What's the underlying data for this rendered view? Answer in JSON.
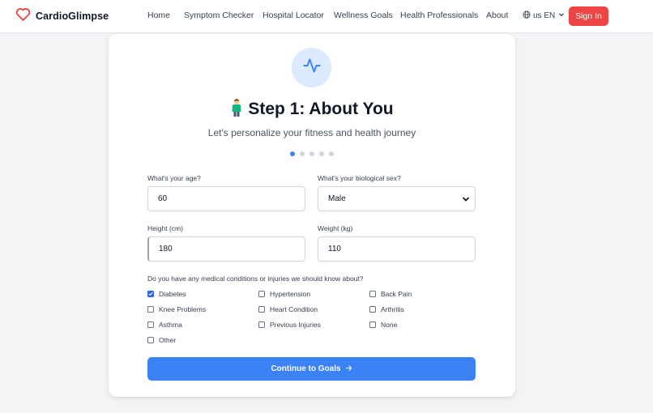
{
  "brand": {
    "name": "CardioGlimpse",
    "accent": "#ef4444"
  },
  "nav": {
    "links": [
      "Home",
      "Symptom Checker",
      "Hospital Locator",
      "Wellness Goals",
      "Health Professionals",
      "About"
    ],
    "language": "us EN",
    "sign_in": "Sign In"
  },
  "step": {
    "icon": "pulse-icon",
    "title": "Step 1: About You",
    "subtitle": "Let's personalize your fitness and health journey",
    "current_step": 1,
    "total_steps": 5
  },
  "form": {
    "age": {
      "label": "What's your age?",
      "value": "60"
    },
    "sex": {
      "label": "What's your biological sex?",
      "value": "Male"
    },
    "height": {
      "label": "Height (cm)",
      "value": "180"
    },
    "weight": {
      "label": "Weight (kg)",
      "value": "110"
    },
    "conditions": {
      "label": "Do you have any medical conditions or injuries we should know about?",
      "options": [
        {
          "label": "Diabetes",
          "checked": true
        },
        {
          "label": "Hypertension",
          "checked": false
        },
        {
          "label": "Back Pain",
          "checked": false
        },
        {
          "label": "Knee Problems",
          "checked": false
        },
        {
          "label": "Heart Condition",
          "checked": false
        },
        {
          "label": "Arthritis",
          "checked": false
        },
        {
          "label": "Asthma",
          "checked": false
        },
        {
          "label": "Previous Injuries",
          "checked": false
        },
        {
          "label": "None",
          "checked": false
        },
        {
          "label": "Other",
          "checked": false
        }
      ]
    },
    "continue_label": "Continue to Goals"
  },
  "colors": {
    "primary": "#3b82f6",
    "signin": "#ef4444",
    "pulse_bg": "#dbeafe"
  }
}
